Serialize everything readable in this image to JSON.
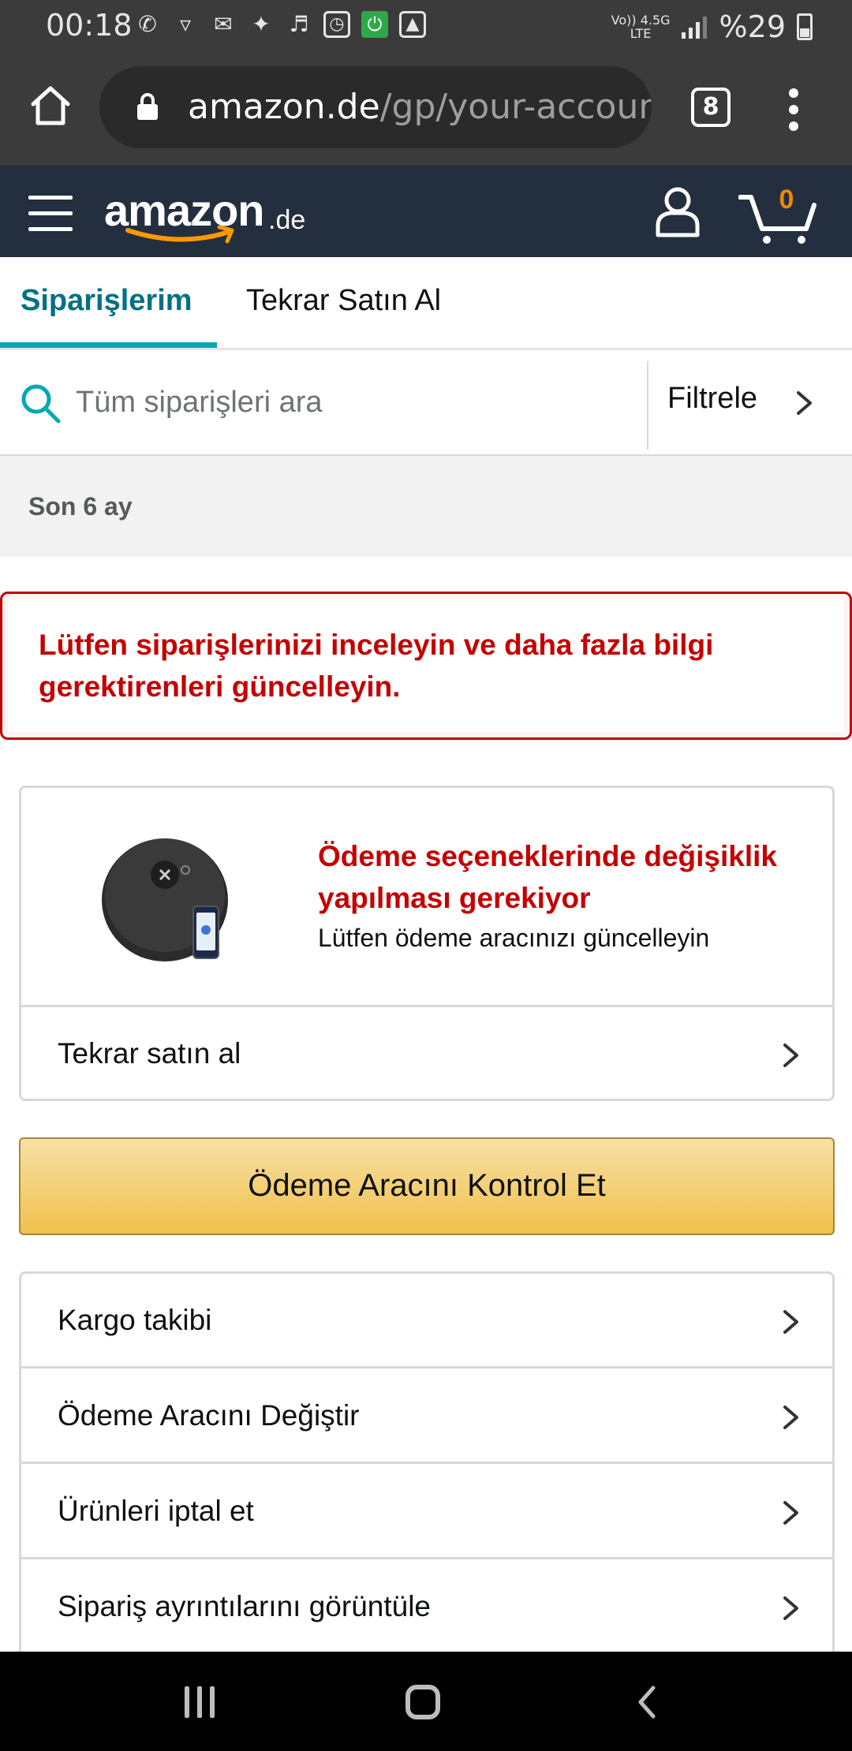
{
  "status_bar": {
    "time": "00:18",
    "network_top": "Vo)) 4.5G",
    "network_bottom": "LTE",
    "battery": "%29"
  },
  "browser": {
    "url_host": "amazon.de",
    "url_path": "/gp/your-accoun",
    "tab_count": "8"
  },
  "header": {
    "logo_word": "amazon",
    "logo_tld": ".de",
    "cart_count": "0"
  },
  "tabs": [
    {
      "label": "Siparişlerim",
      "active": true
    },
    {
      "label": "Tekrar Satın Al",
      "active": false
    }
  ],
  "search": {
    "placeholder": "Tüm siparişleri ara",
    "filter_label": "Filtrele"
  },
  "period": "Son 6 ay",
  "alert": {
    "message": "Lütfen siparişlerinizi inceleyin ve daha fazla bilgi gerektirenleri güncelleyin."
  },
  "order_card": {
    "status_title": "Ödeme seçeneklerinde değişiklik yapılması gerekiyor",
    "status_sub": "Lütfen ödeme aracınızı güncelleyin",
    "buy_again_label": "Tekrar satın al"
  },
  "primary_button": "Ödeme Aracını Kontrol Et",
  "actions": [
    {
      "label": "Kargo takibi"
    },
    {
      "label": "Ödeme Aracını Değiştir"
    },
    {
      "label": "Ürünleri iptal et"
    },
    {
      "label": "Sipariş ayrıntılarını görüntüle"
    }
  ],
  "colors": {
    "header_bg": "#232f3e",
    "accent_teal": "#007185",
    "alert_red": "#c40000",
    "button_yellow": "#f0c14b",
    "cart_orange": "#f08804"
  },
  "icons": [
    "whatsapp-icon",
    "snapchat-icon",
    "mail-icon",
    "twitter-icon",
    "headset-icon",
    "clock-icon",
    "power-icon",
    "gallery-icon",
    "home-icon",
    "lock-icon",
    "menu-dots-icon",
    "hamburger-icon",
    "account-icon",
    "cart-icon",
    "search-icon",
    "chevron-right-icon"
  ]
}
